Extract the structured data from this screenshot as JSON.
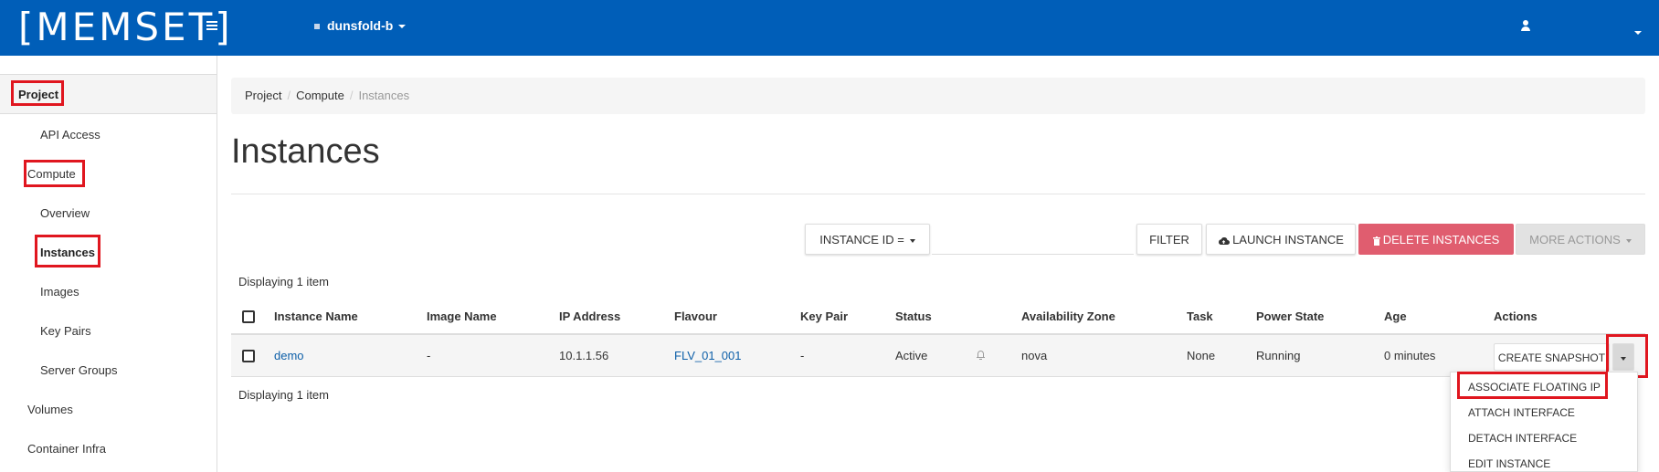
{
  "topbar": {
    "logo": "[MEMSET]",
    "project_name": "dunsfold-b"
  },
  "sidebar": {
    "project": "Project",
    "api_access": "API Access",
    "compute": "Compute",
    "overview": "Overview",
    "instances": "Instances",
    "images": "Images",
    "key_pairs": "Key Pairs",
    "server_groups": "Server Groups",
    "volumes": "Volumes",
    "container_infra": "Container Infra"
  },
  "breadcrumb": [
    "Project",
    "Compute",
    "Instances"
  ],
  "page_title": "Instances",
  "toolbar": {
    "filter_field": "INSTANCE ID =",
    "filter_value": "",
    "filter_button": "FILTER",
    "launch_button": "LAUNCH INSTANCE",
    "delete_button": "DELETE INSTANCES",
    "more_actions": "MORE ACTIONS"
  },
  "item_count": "Displaying 1 item",
  "table": {
    "headers": [
      "Instance Name",
      "Image Name",
      "IP Address",
      "Flavour",
      "Key Pair",
      "Status",
      "Availability Zone",
      "Task",
      "Power State",
      "Age",
      "Actions"
    ],
    "rows": [
      {
        "instance_name": "demo",
        "image_name": "-",
        "ip_address": "10.1.1.56",
        "flavour": "FLV_01_001",
        "key_pair": "-",
        "status": "Active",
        "availability_zone": "nova",
        "task": "None",
        "power_state": "Running",
        "age": "0 minutes",
        "action_button": "CREATE SNAPSHOT"
      }
    ]
  },
  "actions_menu": [
    "ASSOCIATE FLOATING IP",
    "ATTACH INTERFACE",
    "DETACH INTERFACE",
    "EDIT INSTANCE"
  ],
  "colors": {
    "topbar": "#005eb8",
    "danger": "#e05d6f",
    "link": "#0d5fa8",
    "highlight": "#e0161f"
  },
  "icons": [
    "menu-icon",
    "user-icon",
    "cloud-upload-icon",
    "trash-icon",
    "bell-icon"
  ]
}
